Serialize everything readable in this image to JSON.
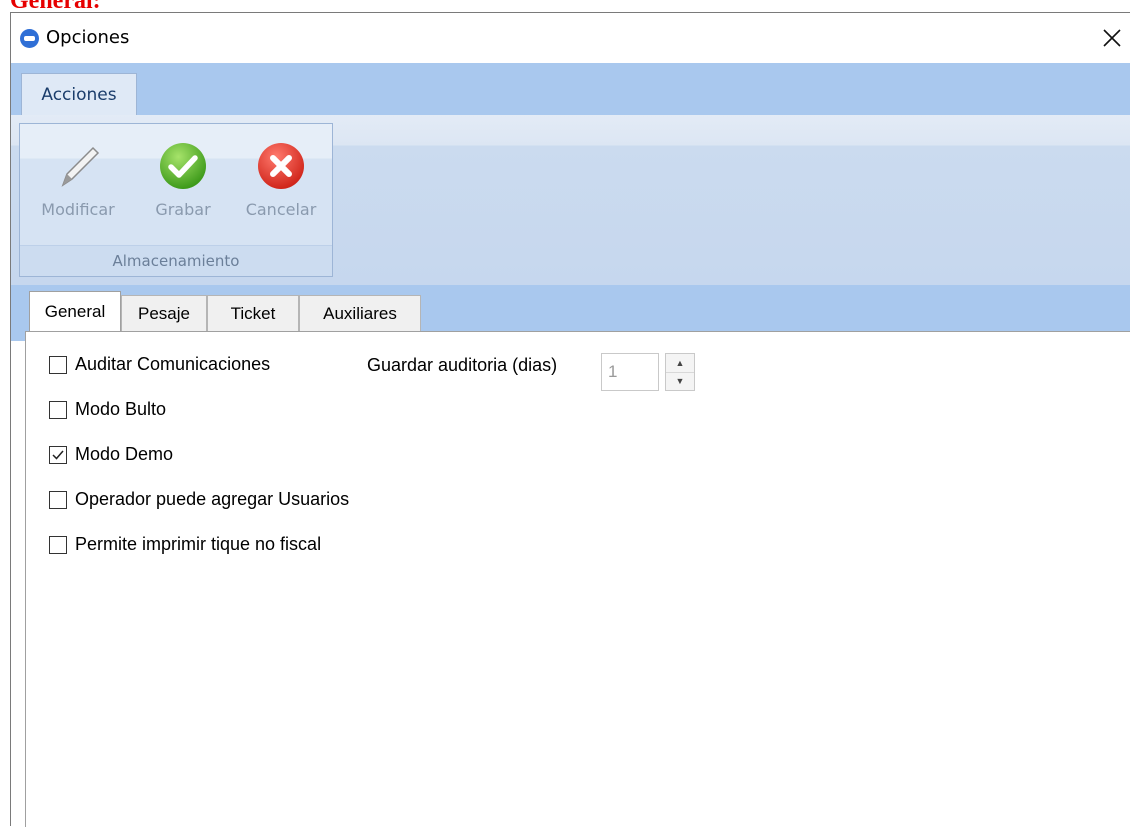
{
  "doc_heading": "General:",
  "window": {
    "title": "Opciones"
  },
  "ribbon": {
    "tab": "Acciones",
    "buttons": [
      {
        "label": "Modificar",
        "icon": "pencil-icon"
      },
      {
        "label": "Grabar",
        "icon": "check-icon"
      },
      {
        "label": "Cancelar",
        "icon": "cancel-icon"
      }
    ],
    "group_label": "Almacenamiento"
  },
  "tabs": [
    "General",
    "Pesaje",
    "Ticket",
    "Auxiliares"
  ],
  "active_tab": "General",
  "options": [
    {
      "label": "Auditar Comunicaciones",
      "checked": false
    },
    {
      "label": "Modo Bulto",
      "checked": false
    },
    {
      "label": "Modo Demo",
      "checked": true
    },
    {
      "label": "Operador puede agregar Usuarios",
      "checked": false
    },
    {
      "label": "Permite imprimir tique no fiscal",
      "checked": false
    }
  ],
  "audit_days": {
    "label": "Guardar auditoria (dias)",
    "value": "1"
  }
}
